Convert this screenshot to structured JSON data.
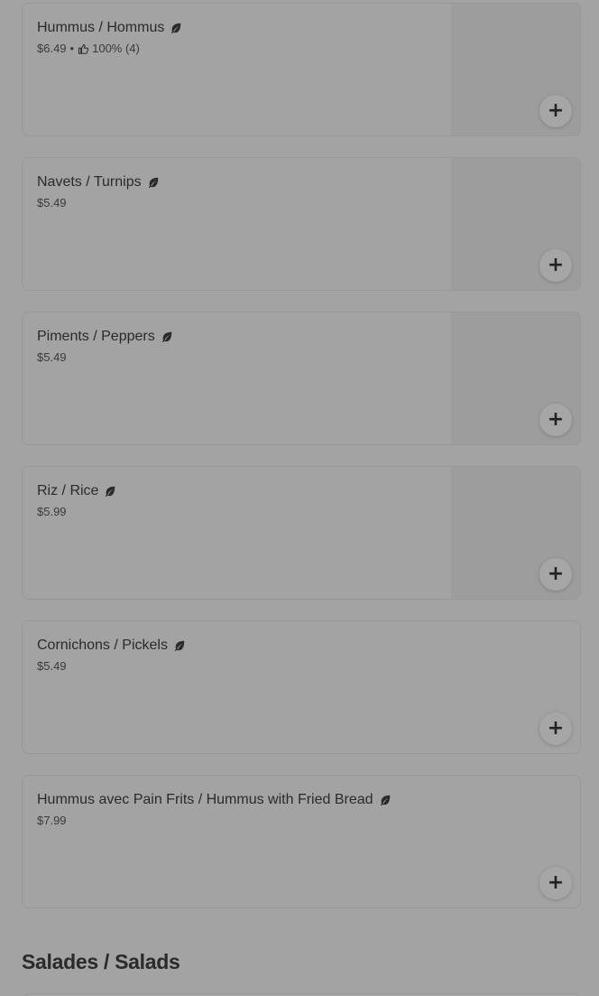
{
  "items": [
    {
      "name": "Hummus / Hommus",
      "price": "$6.49",
      "separator": "•",
      "rating": "100% (4)"
    },
    {
      "name": "Navets / Turnips",
      "price": "$5.49"
    },
    {
      "name": "Piments / Peppers",
      "price": "$5.49"
    },
    {
      "name": "Riz / Rice",
      "price": "$5.99"
    },
    {
      "name": "Cornichons / Pickels",
      "price": "$5.49"
    },
    {
      "name": "Hummus avec Pain Frits / Hummus with Fried Bread",
      "price": "$7.99"
    }
  ],
  "add_label": "+",
  "section": {
    "title": "Salades / Salads"
  },
  "icons": {
    "vegan": "leaf-icon",
    "rating": "thumbs-up-icon",
    "add": "plus-icon"
  },
  "colors": {
    "overlay_bg": "#a3a3a3",
    "text": "#2a2a2a"
  }
}
